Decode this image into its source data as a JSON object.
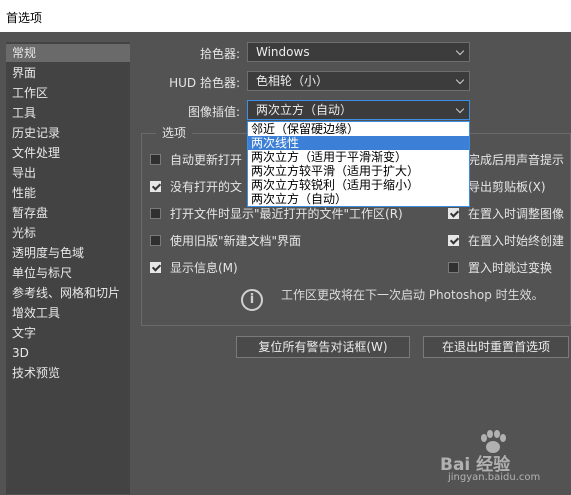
{
  "window": {
    "title": "首选项"
  },
  "sidebar": {
    "items": [
      {
        "label": "常规",
        "selected": true
      },
      {
        "label": "界面"
      },
      {
        "label": "工作区"
      },
      {
        "label": "工具"
      },
      {
        "label": "历史记录"
      },
      {
        "label": "文件处理"
      },
      {
        "label": "导出"
      },
      {
        "label": "性能"
      },
      {
        "label": "暂存盘"
      },
      {
        "label": "光标"
      },
      {
        "label": "透明度与色域"
      },
      {
        "label": "单位与标尺"
      },
      {
        "label": "参考线、网格和切片"
      },
      {
        "label": "增效工具"
      },
      {
        "label": "文字"
      },
      {
        "label": "3D"
      },
      {
        "label": "技术预览"
      }
    ]
  },
  "settings": {
    "color_picker_label": "拾色器:",
    "color_picker_value": "Windows",
    "hud_picker_label": "HUD 拾色器:",
    "hud_picker_value": "色相轮（小）",
    "interpolation_label": "图像插值:",
    "interpolation_value": "两次立方（自动）"
  },
  "interpolation_dropdown": {
    "options": [
      {
        "label": "邻近（保留硬边缘）"
      },
      {
        "label": "两次线性",
        "highlighted": true
      },
      {
        "label": "两次立方（适用于平滑渐变）"
      },
      {
        "label": "两次立方较平滑（适用于扩大）"
      },
      {
        "label": "两次立方较锐利（适用于缩小）"
      },
      {
        "label": "两次立方（自动）"
      }
    ]
  },
  "options_group": {
    "title": "选项",
    "left": [
      {
        "label": "自动更新打开",
        "checked": false
      },
      {
        "label": "没有打开的文",
        "checked": true
      },
      {
        "label": "打开文件时显示\"最近打开的文件\"工作区(R)",
        "checked": false
      },
      {
        "label": "使用旧版\"新建文档\"界面",
        "checked": false
      },
      {
        "label": "显示信息(M)",
        "checked": true
      }
    ],
    "right": [
      {
        "label": "完成后用声音提示",
        "checked": null
      },
      {
        "label": "导出剪贴板(X)",
        "checked": null
      },
      {
        "label": "在置入时调整图像",
        "checked": true
      },
      {
        "label": "在置入时始终创建",
        "checked": true
      },
      {
        "label": "置入时跳过变换",
        "checked": false
      }
    ],
    "info_text": "工作区更改将在下一次启动 Photoshop 时生效。"
  },
  "buttons": {
    "reset_warnings": "复位所有警告对话框(W)",
    "reset_prefs": "在退出时重置首选项"
  },
  "watermark": {
    "text": "Bai 经验",
    "sub": "jingyan.baidu.com"
  }
}
